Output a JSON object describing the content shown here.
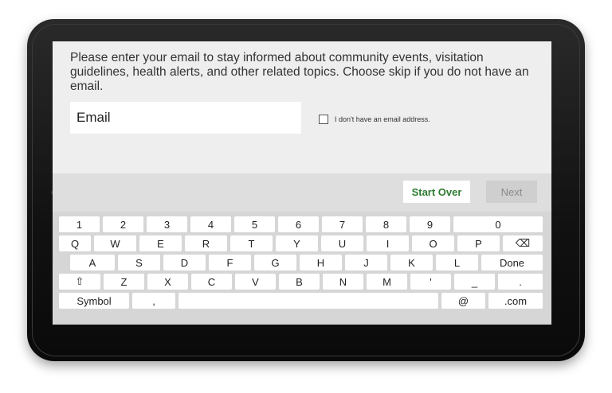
{
  "prompt": "Please enter your email to stay informed about community events, visitation guidelines, health alerts, and other related topics. Choose skip if you do not have an email.",
  "email_placeholder": "Email",
  "no_email_label": "I don't have an email address.",
  "buttons": {
    "start_over": "Start Over",
    "next": "Next"
  },
  "colors": {
    "start_over_text": "#2e7d32",
    "screen_bg": "#eeeeee",
    "keyboard_bg": "#d6d6d6"
  },
  "keyboard": {
    "row1": [
      "1",
      "2",
      "3",
      "4",
      "5",
      "6",
      "7",
      "8",
      "9",
      "0"
    ],
    "row2": [
      "Q",
      "W",
      "E",
      "R",
      "T",
      "Y",
      "U",
      "I",
      "O",
      "P",
      "⌫"
    ],
    "row3": [
      "A",
      "S",
      "D",
      "F",
      "G",
      "H",
      "J",
      "K",
      "L",
      "Done"
    ],
    "row4": [
      "⇧",
      "Z",
      "X",
      "C",
      "V",
      "B",
      "N",
      "M",
      "'",
      "_",
      "."
    ],
    "row5": [
      "Symbol",
      ",",
      "",
      "@",
      ".com"
    ]
  }
}
